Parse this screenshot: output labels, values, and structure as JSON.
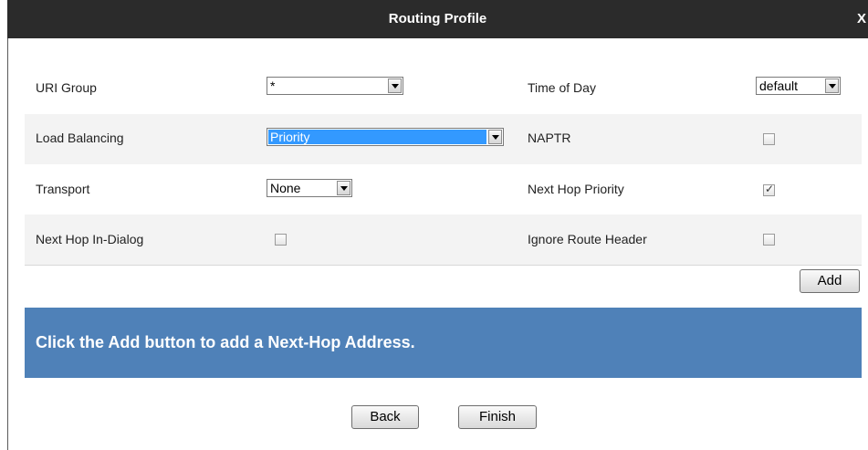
{
  "dialog": {
    "title": "Routing Profile",
    "close_label": "X"
  },
  "form": {
    "uri_group": {
      "label": "URI Group",
      "value": "*"
    },
    "time_of_day": {
      "label": "Time of Day",
      "value": "default"
    },
    "load_balancing": {
      "label": "Load Balancing",
      "value": "Priority"
    },
    "naptr": {
      "label": "NAPTR",
      "checked": false
    },
    "transport": {
      "label": "Transport",
      "value": "None"
    },
    "next_hop_priority": {
      "label": "Next Hop Priority",
      "checked": true
    },
    "next_hop_in_dialog": {
      "label": "Next Hop In-Dialog",
      "checked": false
    },
    "ignore_route_header": {
      "label": "Ignore Route Header",
      "checked": false
    }
  },
  "actions": {
    "add_label": "Add",
    "back_label": "Back",
    "finish_label": "Finish"
  },
  "banner": {
    "message": "Click the Add button to add a Next-Hop Address."
  },
  "colors": {
    "titlebar": "#2b2b2b",
    "banner": "#4f81b8",
    "selection": "#3399ff"
  }
}
